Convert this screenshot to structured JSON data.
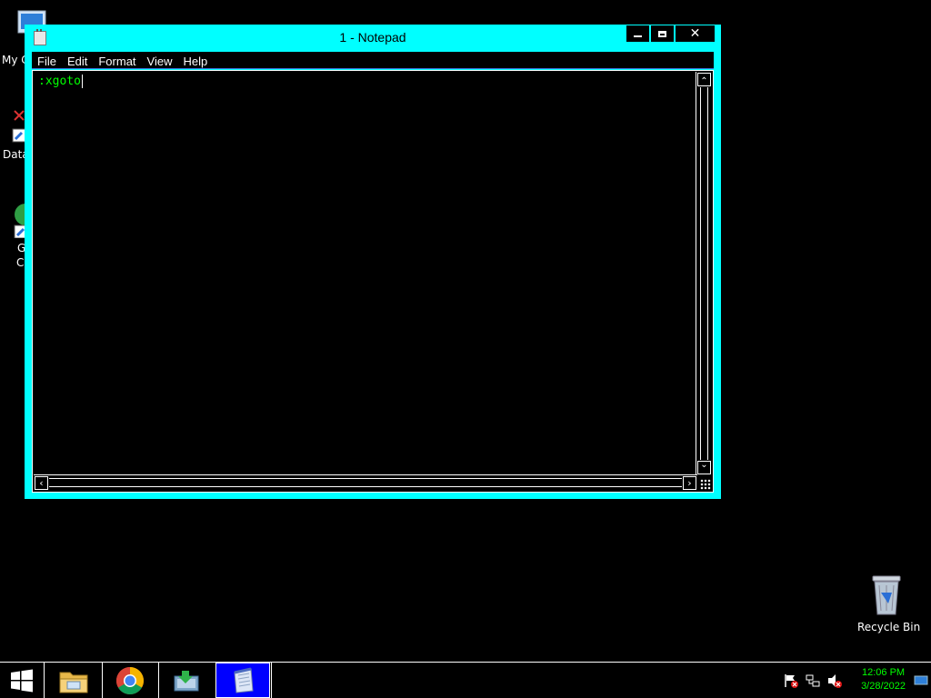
{
  "desktop": {
    "icons": [
      {
        "label": "My C"
      },
      {
        "label": "Data"
      },
      {
        "label": "G"
      },
      {
        "label": "C"
      },
      {
        "label": "Recycle Bin"
      }
    ]
  },
  "window": {
    "title": "1 - Notepad",
    "close_glyph": "✕",
    "menu": [
      "File",
      "Edit",
      "Format",
      "View",
      "Help"
    ],
    "content": ":xgoto",
    "scroll_up": "⌃",
    "scroll_down": "⌄",
    "scroll_left": "‹",
    "scroll_right": "›"
  },
  "taskbar": {
    "clock_time": "12:06 PM",
    "clock_date": "3/28/2022"
  },
  "colors": {
    "window_border": "#00ffff",
    "text": "#00ff00",
    "active_task": "#0000ff"
  },
  "icons": [
    "computer-icon",
    "shortcut-icon",
    "chrome-icon",
    "recycle-bin-icon",
    "windows-logo-icon",
    "file-explorer-icon",
    "sync-app-icon",
    "notepad-icon",
    "flag-icon",
    "network-icon",
    "volume-icon",
    "show-desktop-icon"
  ]
}
